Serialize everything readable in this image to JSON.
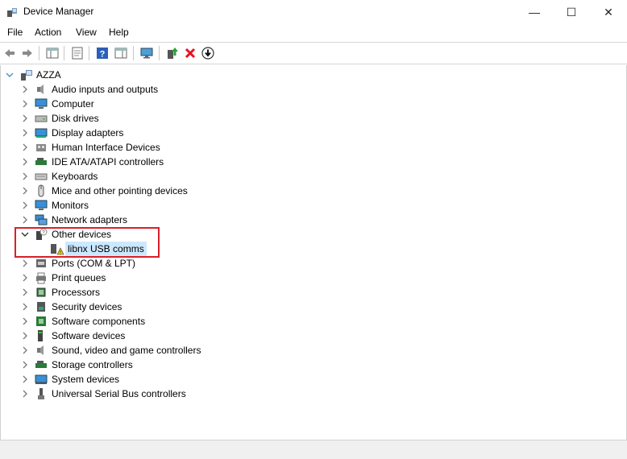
{
  "window": {
    "title": "Device Manager",
    "minimize_glyph": "—",
    "maximize_glyph": "☐",
    "close_glyph": "✕"
  },
  "menu": [
    "File",
    "Action",
    "View",
    "Help"
  ],
  "toolbar": {
    "buttons": [
      "back-icon",
      "forward-icon",
      "show-hide-console-tree-icon",
      "properties-icon",
      "help-icon",
      "action-pane-icon",
      "monitor-icon",
      "update-driver-icon",
      "uninstall-icon",
      "scan-download-icon"
    ]
  },
  "tree": {
    "root": "AZZA",
    "categories": [
      {
        "label": "Audio inputs and outputs",
        "icon": "speaker-icon"
      },
      {
        "label": "Computer",
        "icon": "computer-icon"
      },
      {
        "label": "Disk drives",
        "icon": "disk-drive-icon"
      },
      {
        "label": "Display adapters",
        "icon": "display-adapter-icon"
      },
      {
        "label": "Human Interface Devices",
        "icon": "hid-icon"
      },
      {
        "label": "IDE ATA/ATAPI controllers",
        "icon": "ide-controller-icon"
      },
      {
        "label": "Keyboards",
        "icon": "keyboard-icon"
      },
      {
        "label": "Mice and other pointing devices",
        "icon": "mouse-icon"
      },
      {
        "label": "Monitors",
        "icon": "monitor-icon"
      },
      {
        "label": "Network adapters",
        "icon": "network-adapter-icon"
      },
      {
        "label": "Other devices",
        "icon": "unknown-device-icon",
        "expanded": true,
        "children": [
          {
            "label": "libnx USB comms",
            "icon": "warning-device-icon",
            "selected": true
          }
        ]
      },
      {
        "label": "Ports (COM & LPT)",
        "icon": "port-icon"
      },
      {
        "label": "Print queues",
        "icon": "printer-icon"
      },
      {
        "label": "Processors",
        "icon": "processor-icon"
      },
      {
        "label": "Security devices",
        "icon": "security-device-icon"
      },
      {
        "label": "Software components",
        "icon": "software-component-icon"
      },
      {
        "label": "Software devices",
        "icon": "software-device-icon"
      },
      {
        "label": "Sound, video and game controllers",
        "icon": "sound-icon"
      },
      {
        "label": "Storage controllers",
        "icon": "storage-controller-icon"
      },
      {
        "label": "System devices",
        "icon": "system-device-icon"
      },
      {
        "label": "Universal Serial Bus controllers",
        "icon": "usb-icon"
      }
    ]
  },
  "colors": {
    "selection": "#cce8ff",
    "highlight_box": "#d8202a",
    "uninstall_red": "#e81123"
  }
}
